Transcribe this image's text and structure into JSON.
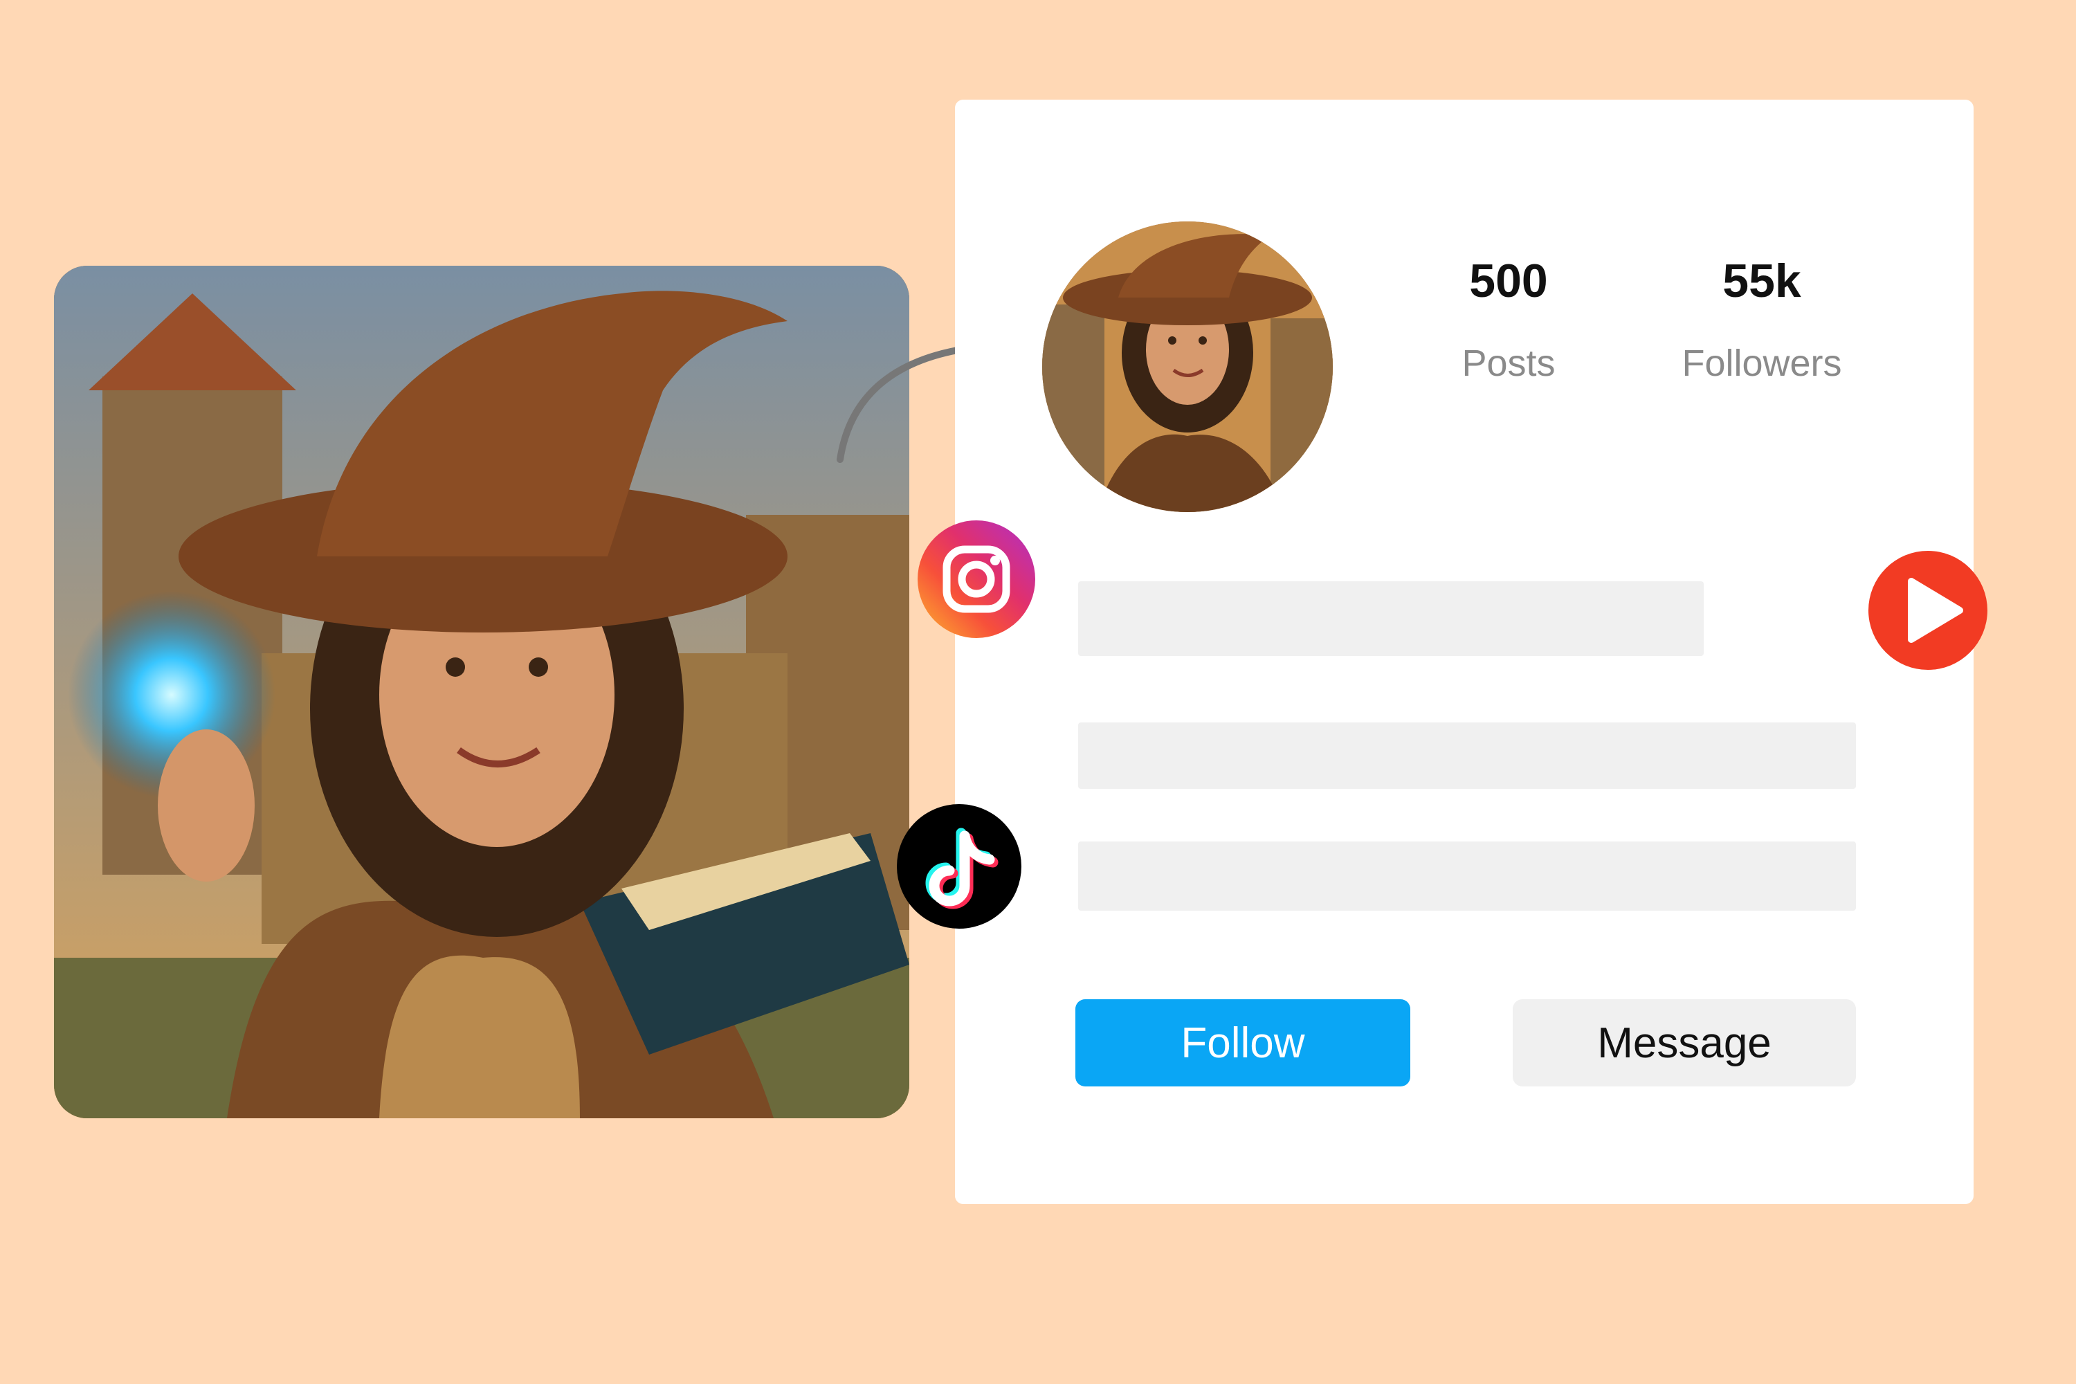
{
  "profile": {
    "stats": [
      {
        "value": "500",
        "label": "Posts"
      },
      {
        "value": "55k",
        "label": "Followers"
      }
    ],
    "follow_label": "Follow",
    "message_label": "Message"
  },
  "icons": {
    "instagram": "instagram-icon",
    "tiktok": "tiktok-icon",
    "youtube": "play-icon"
  },
  "colors": {
    "background": "#FFD8B5",
    "follow_button": "#0AA6F5",
    "instagram_gradient": [
      "#FDB62E",
      "#F7503A",
      "#E1306C",
      "#B02FC9"
    ],
    "play_button": "#F23B23"
  }
}
